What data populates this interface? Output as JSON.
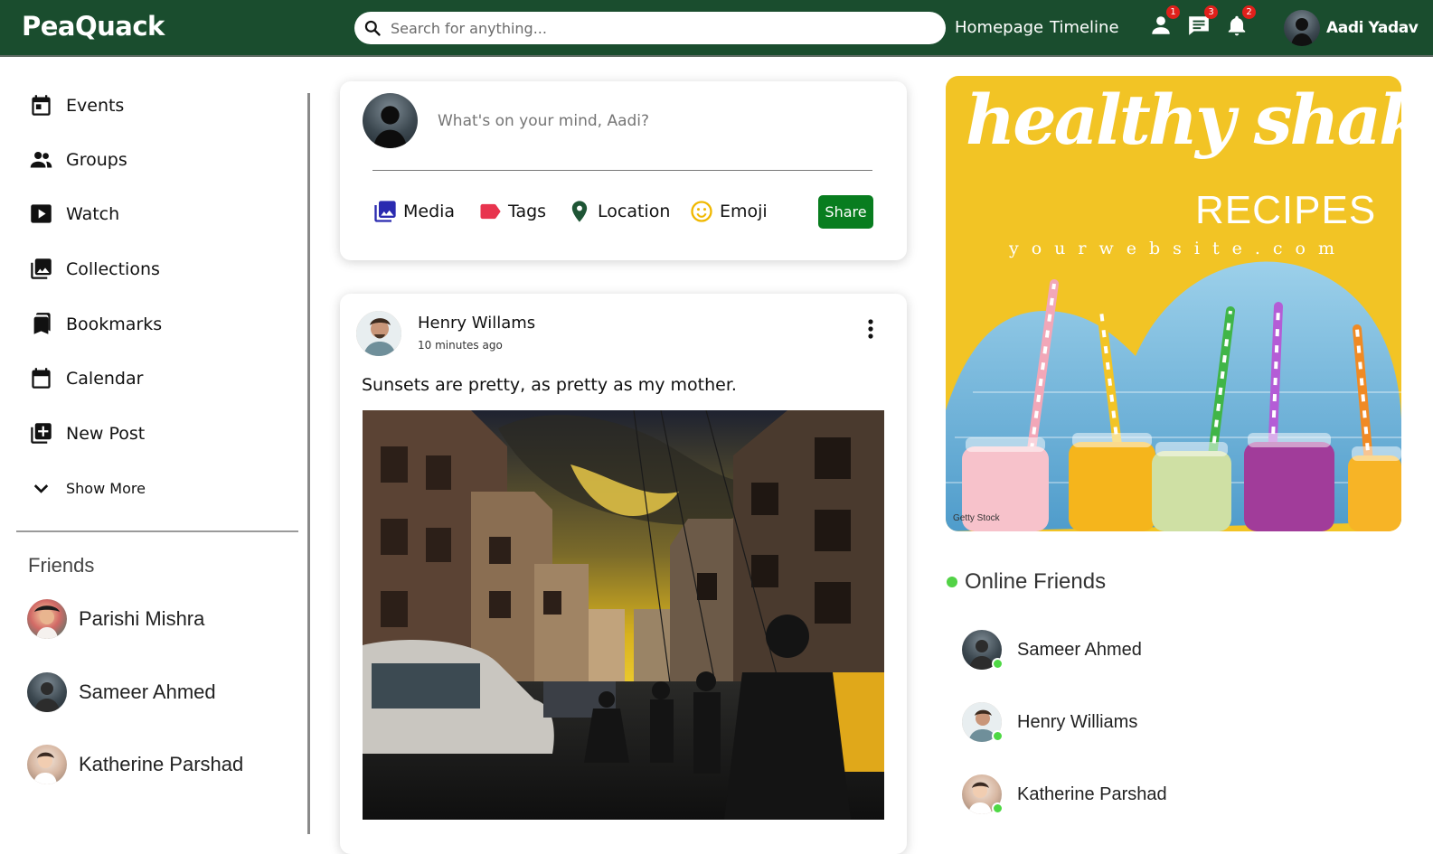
{
  "app": {
    "logo": "PeaQuack"
  },
  "search": {
    "placeholder": "Search for anything..."
  },
  "nav": {
    "links": [
      "Homepage",
      "Timeline"
    ]
  },
  "notifications": {
    "friend_requests": "1",
    "messages": "3",
    "alerts": "2"
  },
  "user": {
    "name": "Aadi Yadav"
  },
  "sidebar": {
    "items": [
      {
        "label": "Events",
        "icon": "calendar-today-icon"
      },
      {
        "label": "Groups",
        "icon": "people-icon"
      },
      {
        "label": "Watch",
        "icon": "play-icon"
      },
      {
        "label": "Collections",
        "icon": "photo-library-icon"
      },
      {
        "label": "Bookmarks",
        "icon": "bookmarks-icon"
      },
      {
        "label": "Calendar",
        "icon": "calendar-icon"
      },
      {
        "label": "New Post",
        "icon": "add-box-icon"
      },
      {
        "label": "Show More",
        "icon": "chevron-down-icon"
      }
    ],
    "friends_title": "Friends",
    "friends": [
      "Parishi Mishra",
      "Sameer Ahmed",
      "Katherine Parshad"
    ]
  },
  "composer": {
    "placeholder": "What's on your mind, Aadi?",
    "options": [
      "Media",
      "Tags",
      "Location",
      "Emoji"
    ],
    "share_label": "Share"
  },
  "post": {
    "author": "Henry Willams",
    "time": "10 minutes ago",
    "caption": "Sunsets are pretty, as pretty as my mother."
  },
  "ad": {
    "headline": "healthy shakes",
    "subheadline": "RECIPES",
    "website": "yourwebsite.com",
    "credit": "Getty Stock"
  },
  "online": {
    "title": "Online Friends",
    "friends": [
      "Sameer Ahmed",
      "Henry Williams",
      "Katherine Parshad"
    ]
  },
  "colors": {
    "topbar": "#1a4d2e",
    "share": "#087d1f",
    "badge": "#e0201b",
    "online": "#4ed844",
    "ad_bg": "#f2c425"
  }
}
